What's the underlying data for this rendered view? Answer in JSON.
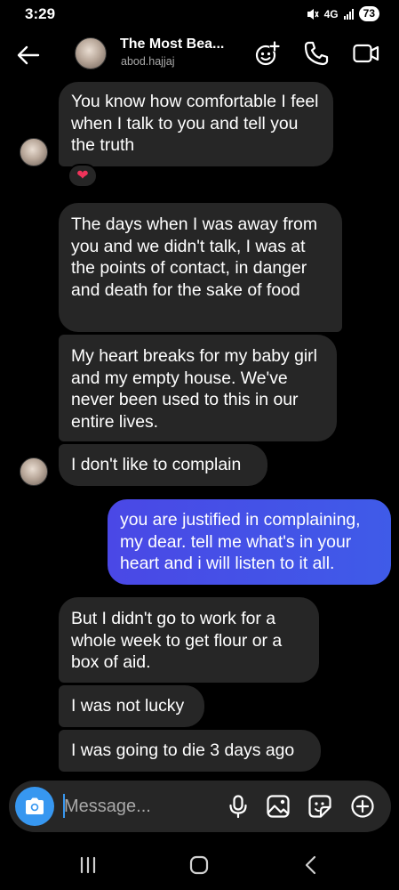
{
  "status_bar": {
    "time": "3:29",
    "network": "4G",
    "battery": "73"
  },
  "header": {
    "title": "The Most Bea...",
    "username": "abod.hajjaj",
    "icons": [
      "back-arrow-icon",
      "video-effects-icon",
      "phone-icon",
      "video-camera-icon"
    ]
  },
  "messages": [
    {
      "direction": "incoming",
      "text": "You know how comfortable I feel when I talk to you and tell you the truth",
      "reaction": "❤"
    },
    {
      "direction": "incoming",
      "text": "The days when I was away from you and we didn't talk, I was at the points of contact, in danger and death for the sake of food"
    },
    {
      "direction": "incoming",
      "text": "My heart breaks for my baby girl and my empty house. We've never been used to this in our entire lives."
    },
    {
      "direction": "incoming",
      "text": "I don't like to complain"
    },
    {
      "direction": "outgoing",
      "text": "you are justified in complaining, my dear. tell me what's in your heart and i will listen to it all."
    },
    {
      "direction": "incoming",
      "text": "But I didn't go to work for a whole week to get flour or a box of aid."
    },
    {
      "direction": "incoming",
      "text": "I was not lucky"
    },
    {
      "direction": "incoming",
      "text": "I was going to die 3 days ago"
    }
  ],
  "composer": {
    "placeholder": "Message...",
    "icons": [
      "camera-icon",
      "microphone-icon",
      "gallery-icon",
      "sticker-icon",
      "plus-icon"
    ]
  },
  "nav_bar": {
    "icons": [
      "recent-apps-icon",
      "home-icon",
      "back-icon"
    ]
  },
  "colors": {
    "background": "#000000",
    "incoming_bubble": "#262626",
    "outgoing_bubble_start": "#4a48e6",
    "outgoing_bubble_end": "#3f5be8",
    "accent": "#3797f0",
    "reaction_heart": "#f0335a"
  }
}
